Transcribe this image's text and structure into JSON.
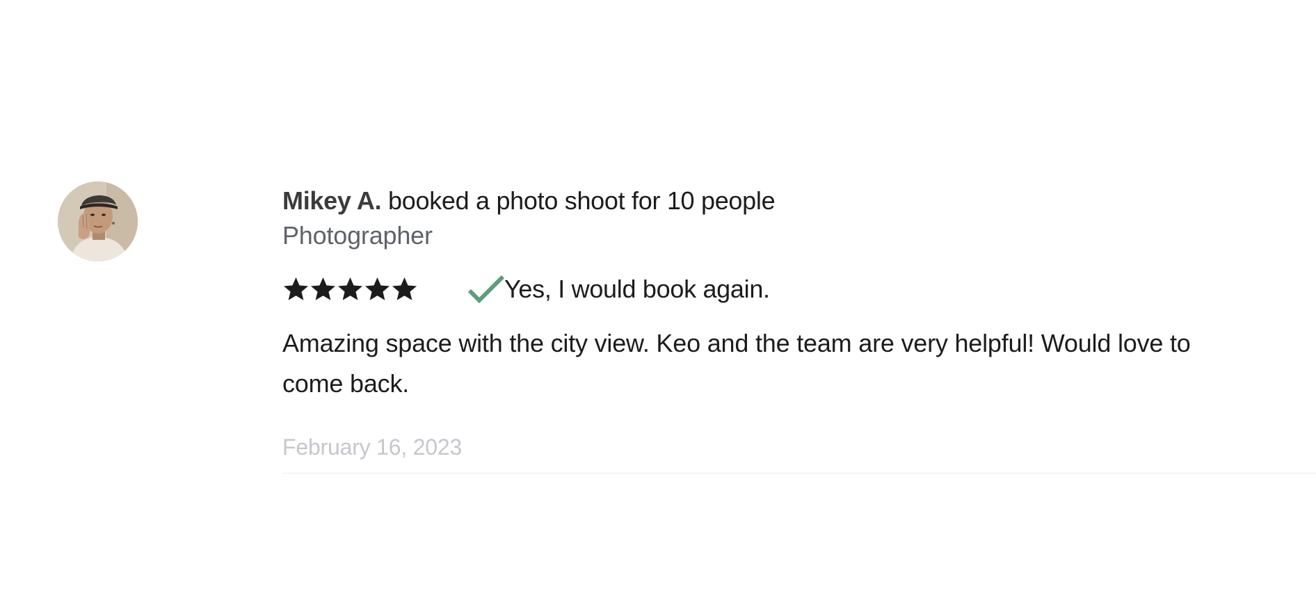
{
  "review": {
    "reviewer_name": "Mikey A.",
    "headline_rest": " booked a photo shoot for 10 people",
    "role": "Photographer",
    "rating": 5,
    "rating_max": 5,
    "book_again_label": "Yes, I would book again.",
    "text": "Amazing space with the city view. Keo and the team are very helpful! Would love to come back.",
    "date": "February 16, 2023"
  },
  "icons": {
    "avatar": "avatar-photo",
    "star": "star-icon",
    "check": "checkmark-icon"
  },
  "colors": {
    "star": "#1c1c1c",
    "check": "#5e9e7f",
    "role_text": "#5f6368",
    "date_text": "#c4c7cc",
    "divider": "#ececec"
  }
}
